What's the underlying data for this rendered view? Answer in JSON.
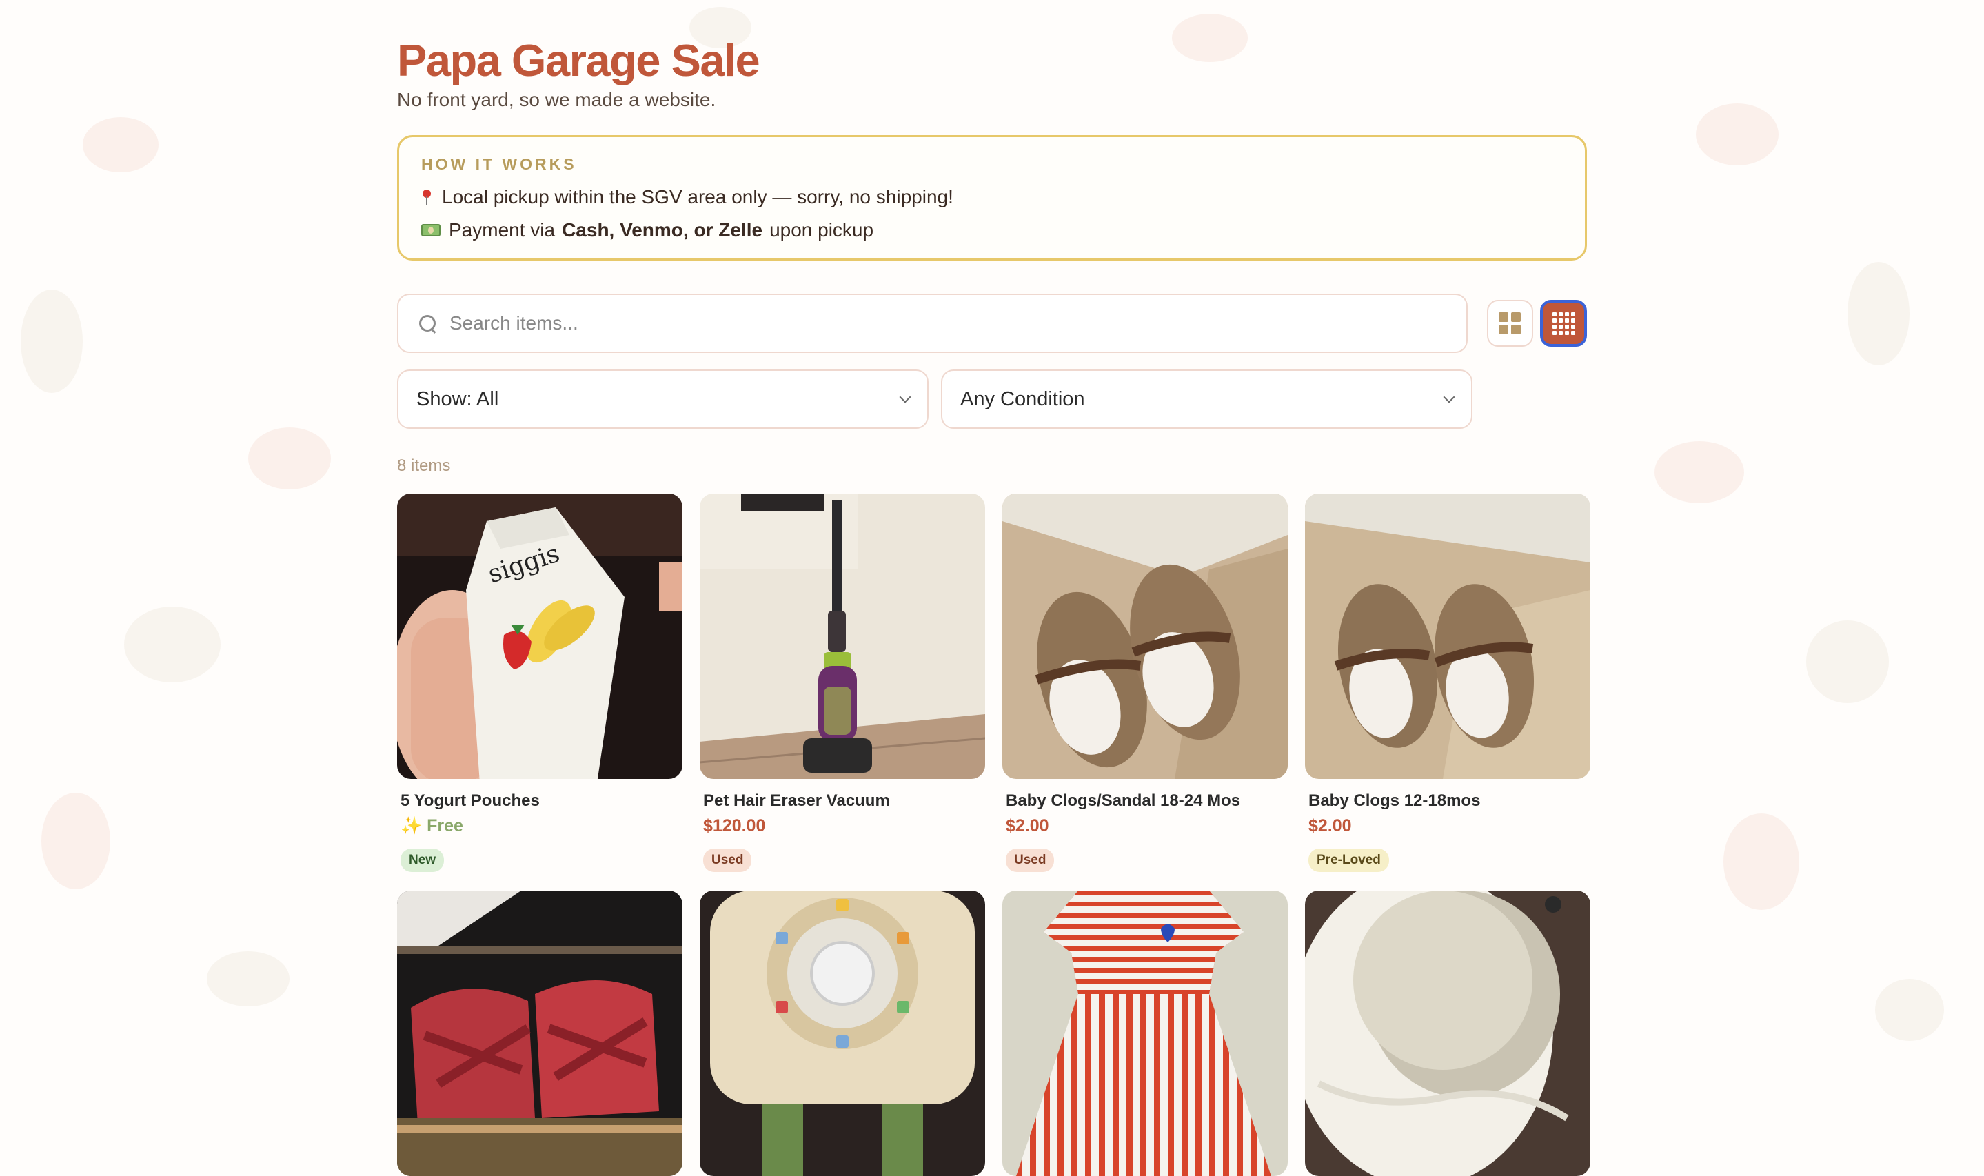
{
  "header": {
    "title": "Papa Garage Sale",
    "subtitle": "No front yard, so we made a website."
  },
  "how_it_works": {
    "heading": "HOW IT WORKS",
    "line1": "Local pickup within the SGV area only — sorry, no shipping!",
    "line2_prefix": "Payment via",
    "line2_bold": "Cash, Venmo, or Zelle",
    "line2_suffix": "upon pickup",
    "line1_icon": "pin-icon",
    "line2_icon": "money-icon"
  },
  "search": {
    "placeholder": "Search items..."
  },
  "view_toggle": {
    "options": [
      "grid-large-icon",
      "grid-small-icon"
    ],
    "selected": "grid-small-icon"
  },
  "filters": {
    "show": "Show: All",
    "condition": "Any Condition"
  },
  "item_count": "8 items",
  "products": [
    {
      "name": "5 Yogurt Pouches",
      "price": "✨ Free",
      "condition": "New",
      "badge_color": "#dcefd6"
    },
    {
      "name": "Pet Hair Eraser Vacuum",
      "price": "$120.00",
      "condition": "Used",
      "badge_color": "#f8e0d4"
    },
    {
      "name": "Baby Clogs/Sandal 18-24 Mos",
      "price": "$2.00",
      "condition": "Used",
      "badge_color": "#f8e0d4"
    },
    {
      "name": "Baby Clogs 12-18mos",
      "price": "$2.00",
      "condition": "Pre-Loved",
      "badge_color": "#f6efc8"
    },
    {
      "name": "",
      "price": "",
      "condition": ""
    },
    {
      "name": "",
      "price": "",
      "condition": ""
    },
    {
      "name": "",
      "price": "",
      "condition": ""
    },
    {
      "name": "",
      "price": "",
      "condition": ""
    }
  ],
  "colors": {
    "accent": "#c0573a",
    "border_gold": "#e7c86a",
    "focus_ring": "#3b63d8"
  }
}
